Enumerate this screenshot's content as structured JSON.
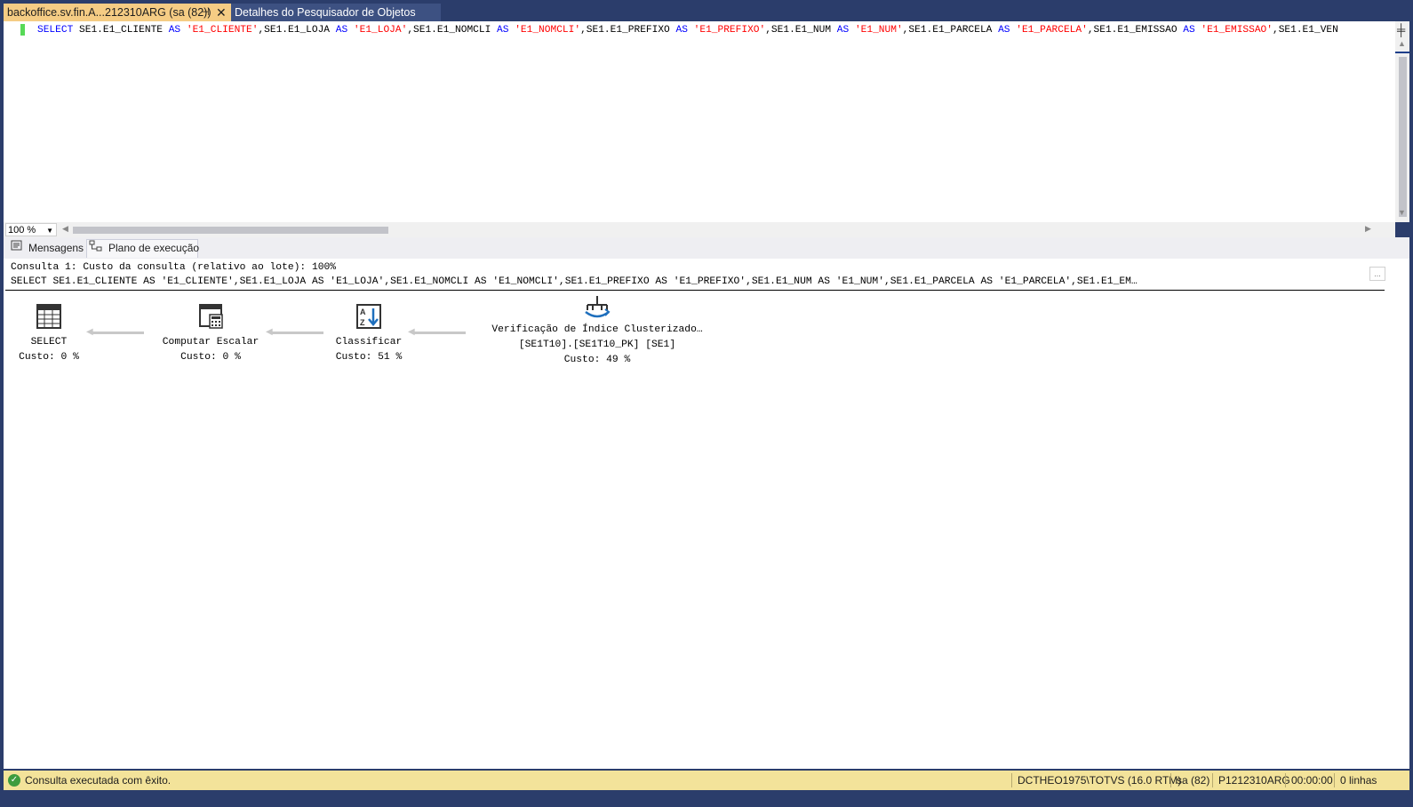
{
  "tabs": {
    "active": {
      "label": "backoffice.sv.fin.A...212310ARG (sa (82))",
      "pin": "⊣",
      "close": "✕"
    },
    "inactive": {
      "label": "Detalhes do Pesquisador de Objetos"
    }
  },
  "editor": {
    "sql_tokens": [
      {
        "t": "SELECT",
        "c": "kw"
      },
      {
        "t": " SE1.E1_CLIENTE ",
        "c": ""
      },
      {
        "t": "AS",
        "c": "kw"
      },
      {
        "t": " ",
        "c": ""
      },
      {
        "t": "'E1_CLIENTE'",
        "c": "str"
      },
      {
        "t": ",SE1.E1_LOJA ",
        "c": ""
      },
      {
        "t": "AS",
        "c": "kw"
      },
      {
        "t": " ",
        "c": ""
      },
      {
        "t": "'E1_LOJA'",
        "c": "str"
      },
      {
        "t": ",SE1.E1_NOMCLI ",
        "c": ""
      },
      {
        "t": "AS",
        "c": "kw"
      },
      {
        "t": " ",
        "c": ""
      },
      {
        "t": "'E1_NOMCLI'",
        "c": "str"
      },
      {
        "t": ",SE1.E1_PREFIXO ",
        "c": ""
      },
      {
        "t": "AS",
        "c": "kw"
      },
      {
        "t": " ",
        "c": ""
      },
      {
        "t": "'E1_PREFIXO'",
        "c": "str"
      },
      {
        "t": ",SE1.E1_NUM ",
        "c": ""
      },
      {
        "t": "AS",
        "c": "kw"
      },
      {
        "t": " ",
        "c": ""
      },
      {
        "t": "'E1_NUM'",
        "c": "str"
      },
      {
        "t": ",SE1.E1_PARCELA ",
        "c": ""
      },
      {
        "t": "AS",
        "c": "kw"
      },
      {
        "t": " ",
        "c": ""
      },
      {
        "t": "'E1_PARCELA'",
        "c": "str"
      },
      {
        "t": ",SE1.E1_EMISSAO ",
        "c": ""
      },
      {
        "t": "AS",
        "c": "kw"
      },
      {
        "t": " ",
        "c": ""
      },
      {
        "t": "'E1_EMISSAO'",
        "c": "str"
      },
      {
        "t": ",SE1.E1_VEN",
        "c": ""
      }
    ],
    "zoom": "100 %"
  },
  "result_tabs": [
    {
      "label": "Mensagens",
      "icon": "messages-icon"
    },
    {
      "label": "Plano de execução",
      "icon": "execution-plan-icon"
    }
  ],
  "plan": {
    "header_line1": "Consulta 1: Custo da consulta (relativo ao lote): 100%",
    "header_line2": "SELECT SE1.E1_CLIENTE AS 'E1_CLIENTE',SE1.E1_LOJA AS 'E1_LOJA',SE1.E1_NOMCLI AS 'E1_NOMCLI',SE1.E1_PREFIXO AS 'E1_PREFIXO',SE1.E1_NUM AS 'E1_NUM',SE1.E1_PARCELA AS 'E1_PARCELA',SE1.E1_EM…",
    "more": "...",
    "operators": {
      "select": {
        "name": "SELECT",
        "cost": "Custo: 0 %",
        "icon": "select-result-icon"
      },
      "compute": {
        "name": "Computar Escalar",
        "cost": "Custo: 0 %",
        "icon": "compute-scalar-icon"
      },
      "sort": {
        "name": "Classificar",
        "cost": "Custo: 51 %",
        "icon": "sort-icon"
      },
      "scan": {
        "name": "Verificação de Índice Clusterizado…",
        "object": "[SE1T10].[SE1T10_PK] [SE1]",
        "cost": "Custo: 49 %",
        "icon": "clustered-index-scan-icon"
      }
    }
  },
  "status": {
    "message": "Consulta executada com êxito.",
    "server": "DCTHEO1975\\TOTVS (16.0 RTM)",
    "user": "sa (82)",
    "database": "P1212310ARG",
    "elapsed": "00:00:00",
    "rows": "0 linhas"
  },
  "colors": {
    "frame": "#2b3d6b",
    "active_tab": "#f5cc84",
    "keyword": "#0000ff",
    "string": "#ff0000",
    "status_bar": "#f3e39a",
    "icon_accent": "#1e6fbd"
  }
}
